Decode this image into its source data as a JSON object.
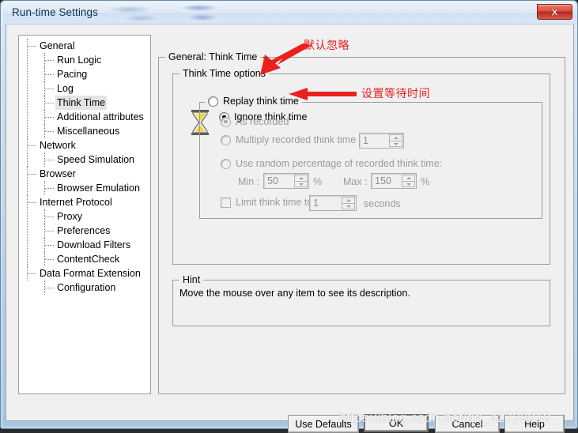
{
  "window": {
    "title": "Run-time Settings",
    "close_label": "Close"
  },
  "sidebar": {
    "items": [
      {
        "label": "General",
        "level": 1,
        "selected": false
      },
      {
        "label": "Run Logic",
        "level": 2,
        "selected": false
      },
      {
        "label": "Pacing",
        "level": 2,
        "selected": false
      },
      {
        "label": "Log",
        "level": 2,
        "selected": false
      },
      {
        "label": "Think Time",
        "level": 2,
        "selected": true
      },
      {
        "label": "Additional attributes",
        "level": 2,
        "selected": false
      },
      {
        "label": "Miscellaneous",
        "level": 2,
        "selected": false
      },
      {
        "label": "Network",
        "level": 1,
        "selected": false
      },
      {
        "label": "Speed Simulation",
        "level": 2,
        "selected": false
      },
      {
        "label": "Browser",
        "level": 1,
        "selected": false
      },
      {
        "label": "Browser Emulation",
        "level": 2,
        "selected": false
      },
      {
        "label": "Internet Protocol",
        "level": 1,
        "selected": false
      },
      {
        "label": "Proxy",
        "level": 2,
        "selected": false
      },
      {
        "label": "Preferences",
        "level": 2,
        "selected": false
      },
      {
        "label": "Download Filters",
        "level": 2,
        "selected": false
      },
      {
        "label": "ContentCheck",
        "level": 2,
        "selected": false
      },
      {
        "label": "Data Format Extension",
        "level": 1,
        "selected": false
      },
      {
        "label": "Configuration",
        "level": 2,
        "selected": false
      }
    ]
  },
  "main": {
    "group_title": "General: Think Time",
    "options_group_title": "Think Time options",
    "ignore_think_time": {
      "label": "Ignore think time",
      "checked": true,
      "disabled": false
    },
    "replay_think_time": {
      "label": "Replay think time",
      "checked": false,
      "disabled": false
    },
    "as_recorded": {
      "label": "As recorded",
      "checked": true,
      "disabled": true
    },
    "multiply": {
      "label": "Multiply recorded think time by:",
      "checked": false,
      "disabled": true,
      "value": "1"
    },
    "random_percentage": {
      "label": "Use random percentage of recorded think time:",
      "checked": false,
      "disabled": true
    },
    "min": {
      "label": "Min :",
      "value": "50",
      "unit": "%"
    },
    "max": {
      "label": "Max :",
      "value": "150",
      "unit": "%"
    },
    "limit_think_time": {
      "label": "Limit think time to:",
      "checked": false,
      "disabled": true,
      "value": "1",
      "unit": "seconds"
    },
    "hint": {
      "title": "Hint",
      "text": "Move the mouse over any item to see its description."
    }
  },
  "footer": {
    "use_defaults": "Use Defaults",
    "ok": "OK",
    "cancel": "Cancel",
    "help": "Help"
  },
  "annotations": [
    {
      "text": "默认忽略",
      "color": "#e8211f"
    },
    {
      "text": "设置等待时间",
      "color": "#e8211f"
    }
  ],
  "watermark": {
    "text": "https://blog.csdn.net/qq_42729018"
  },
  "colors": {
    "annotation_red": "#e8211f",
    "close_button_red": "#b9281a",
    "title_text": "#0c2f4f",
    "disabled_text": "#9a9a9a",
    "panel_bg": "#f0f0f0"
  }
}
